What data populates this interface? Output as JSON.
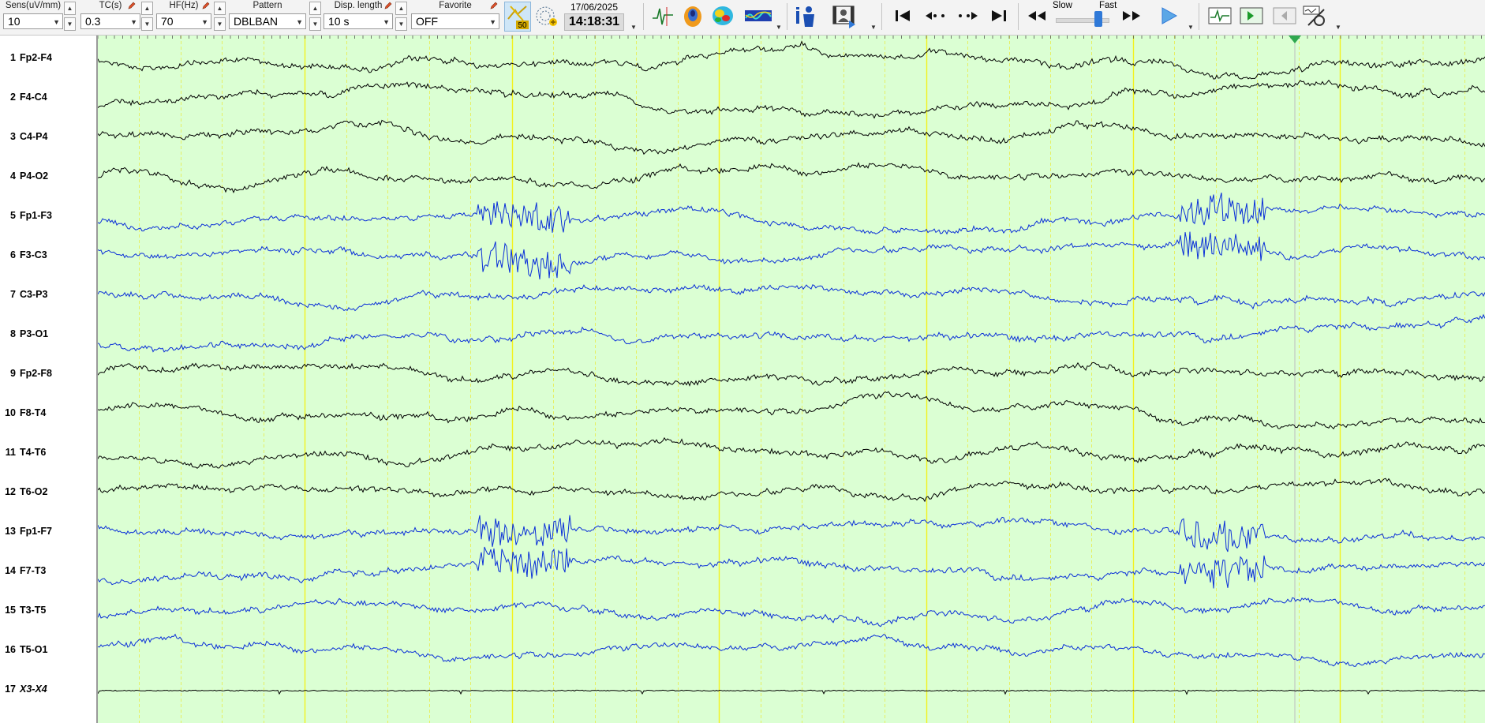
{
  "toolbar": {
    "sensitivity": {
      "label": "Sens(uV/mm)",
      "value": "10"
    },
    "time_constant": {
      "label": "TC(s)",
      "value": "0.3"
    },
    "high_filter": {
      "label": "HF(Hz)",
      "value": "70"
    },
    "pattern": {
      "label": "Pattern",
      "value": "DBLBAN"
    },
    "display_length": {
      "label": "Disp. length",
      "value": "10 s"
    },
    "favorite": {
      "label": "Favorite",
      "value": "OFF"
    },
    "notch_badge": "50",
    "date": "17/06/2025",
    "time": "14:18:31",
    "speed": {
      "slow_label": "Slow",
      "fast_label": "Fast",
      "level": 0.82
    }
  },
  "channels": [
    {
      "num": "1",
      "name": "Fp2-F4",
      "color": "#000000",
      "italic": false
    },
    {
      "num": "2",
      "name": "F4-C4",
      "color": "#000000",
      "italic": false
    },
    {
      "num": "3",
      "name": "C4-P4",
      "color": "#000000",
      "italic": false
    },
    {
      "num": "4",
      "name": "P4-O2",
      "color": "#000000",
      "italic": false
    },
    {
      "num": "5",
      "name": "Fp1-F3",
      "color": "#0a2fd8",
      "italic": false
    },
    {
      "num": "6",
      "name": "F3-C3",
      "color": "#0a2fd8",
      "italic": false
    },
    {
      "num": "7",
      "name": "C3-P3",
      "color": "#0a2fd8",
      "italic": false
    },
    {
      "num": "8",
      "name": "P3-O1",
      "color": "#0a2fd8",
      "italic": false
    },
    {
      "num": "9",
      "name": "Fp2-F8",
      "color": "#000000",
      "italic": false
    },
    {
      "num": "10",
      "name": "F8-T4",
      "color": "#000000",
      "italic": false
    },
    {
      "num": "11",
      "name": "T4-T6",
      "color": "#000000",
      "italic": false
    },
    {
      "num": "12",
      "name": "T6-O2",
      "color": "#000000",
      "italic": false
    },
    {
      "num": "13",
      "name": "Fp1-F7",
      "color": "#0a2fd8",
      "italic": false
    },
    {
      "num": "14",
      "name": "F7-T3",
      "color": "#0a2fd8",
      "italic": false
    },
    {
      "num": "15",
      "name": "T3-T5",
      "color": "#0a2fd8",
      "italic": false
    },
    {
      "num": "16",
      "name": "T5-O1",
      "color": "#0a2fd8",
      "italic": false
    },
    {
      "num": "17",
      "name": "X3-X4",
      "color": "#000000",
      "italic": true
    }
  ],
  "colors": {
    "background": "#dbffd3",
    "major_gridline": "#f2f21e",
    "minor_gridline": "#e6ef64",
    "marker": "#2fa84f",
    "channel_right": "#000000",
    "channel_left": "#0a2fd8"
  }
}
